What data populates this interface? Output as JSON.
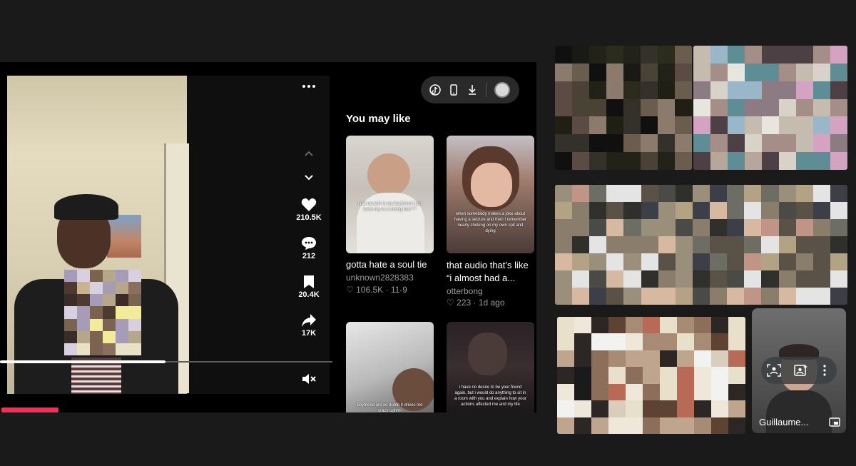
{
  "video": {
    "likes": "210.5K",
    "comments": "212",
    "saves": "20.4K",
    "shares": "17K",
    "progress": 0.5,
    "icons": [
      "more-icon",
      "chevron-up-icon",
      "chevron-down-icon",
      "heart-icon",
      "comment-icon",
      "bookmark-icon",
      "share-icon",
      "mute-icon"
    ]
  },
  "toolbar": {
    "icons": [
      "tiktok-icon",
      "device-icon",
      "download-icon",
      "avatar"
    ]
  },
  "recommendations": {
    "title": "You may like",
    "cards": [
      {
        "title": "gotta hate a soul tie",
        "author": "unknown2828383",
        "likes": "106.5K",
        "date": "11-9",
        "caption": "i ran up aslk to my boyfriend I just know my ex is doing bad ***"
      },
      {
        "title": "that audio that’s like “i almost had a...",
        "author": "otterbong",
        "likes": "223",
        "date": "1d ago",
        "caption": "when somebody makes a joke about having a seizure and then I remember nearly choking on my own spit and dying"
      },
      {
        "title": "",
        "author": "",
        "likes": "",
        "date": "",
        "caption": "boyfriend are so dumb it drives me crazy ughhh"
      },
      {
        "title": "",
        "author": "",
        "likes": "",
        "date": "",
        "caption": "i have no desire to be your friend again, but i would do anything to sit in a room with you and explain how your actions affected me and my life"
      }
    ]
  },
  "meet": {
    "self_name": "Guillaume...",
    "self_controls": [
      "frame-person-icon",
      "edit-background-icon",
      "more-vert-icon"
    ],
    "pip_icon": "picture-in-picture-icon"
  },
  "colors": {
    "accent": "#fe2c55",
    "background": "#1a1a1a",
    "screen": "#000000"
  }
}
